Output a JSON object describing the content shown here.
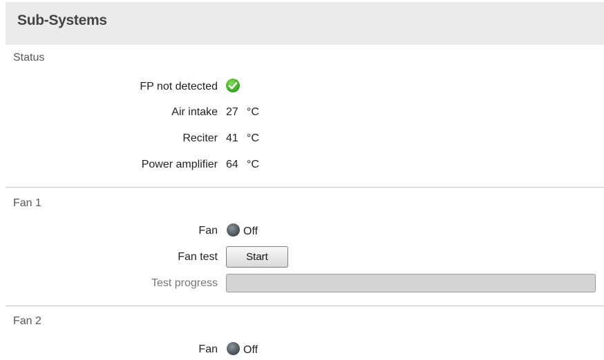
{
  "panel": {
    "title": "Sub-Systems"
  },
  "status": {
    "title": "Status",
    "fp_label": "FP not detected",
    "fp_state": "ok",
    "readings": [
      {
        "label": "Air intake",
        "value": "27",
        "unit": "°C"
      },
      {
        "label": "Reciter",
        "value": "41",
        "unit": "°C"
      },
      {
        "label": "Power amplifier",
        "value": "64",
        "unit": "°C"
      }
    ]
  },
  "fan1": {
    "title": "Fan 1",
    "fan_label": "Fan",
    "fan_state": "Off",
    "test_label": "Fan test",
    "start_label": "Start",
    "progress_label": "Test progress",
    "progress_fraction": 0
  },
  "fan2": {
    "title": "Fan 2",
    "fan_label": "Fan",
    "fan_state": "Off"
  },
  "colors": {
    "ok": "#33a51f",
    "led_off": "#4a5158",
    "header_bg": "#ebebeb"
  },
  "icons": {
    "fp_status": "check-circle-icon",
    "fan_led": "led-indicator-icon"
  }
}
